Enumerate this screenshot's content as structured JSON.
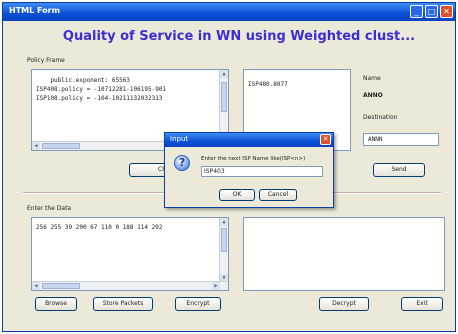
{
  "window": {
    "title": "HTML Form",
    "minimize": "_",
    "maximize": "□",
    "close": "✕"
  },
  "app_title": "Quality of Service in WN using Weighted clust...",
  "policy_frame": {
    "label": "Policy Frame",
    "lines": [
      "    public.exponent: 65563",
      "",
      "ISP408.policy = -10712281-106195-901",
      "ISP108.policy = -104-10211132032313"
    ]
  },
  "right_top_field": {
    "text": "ISP480.8077"
  },
  "side_panel": {
    "name_label": "Name",
    "name_value": "ANNO",
    "destination_label": "Destination",
    "destination_value": "ANNN"
  },
  "data_frame": {
    "label": "Enter the Data",
    "text": "256 255 39 200 67 110 0 188 114 202"
  },
  "buttons": {
    "middle_partial": "Ch",
    "send": "Send",
    "browse": "Browse",
    "store_packets": "Store Packets",
    "encrypt": "Encrypt",
    "decrypt": "Decrypt",
    "exit": "Exit"
  },
  "dialog": {
    "title": "Input",
    "prompt": "Enter the next ISP Name like(ISP<n>)",
    "input_value": "ISP403",
    "ok": "OK",
    "cancel": "Cancel",
    "close": "✕"
  }
}
